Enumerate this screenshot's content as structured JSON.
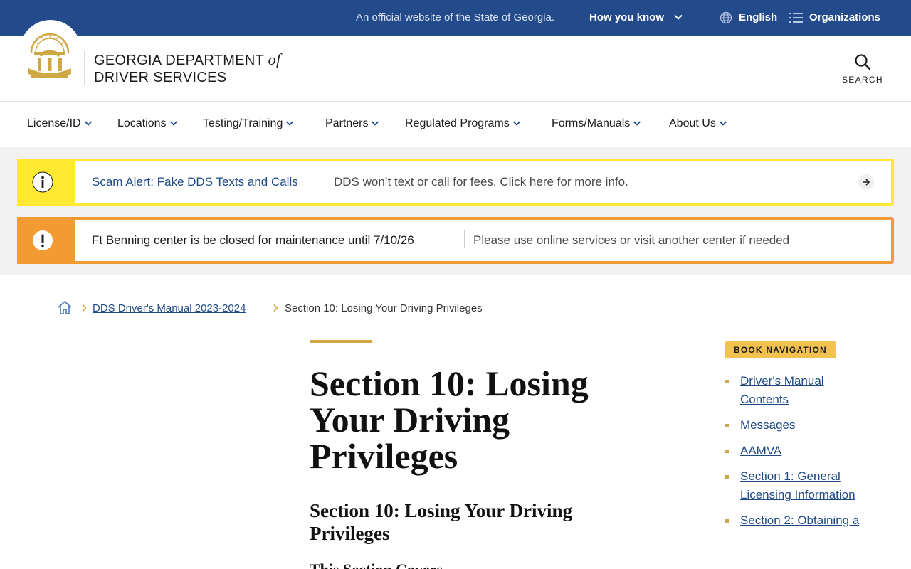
{
  "gov_bar": {
    "official_text": "An official website of the State of Georgia.",
    "how_you_know": "How you know",
    "language": "English",
    "organizations": "Organizations"
  },
  "header": {
    "brand_line1": "GEORGIA DEPARTMENT",
    "brand_of": "of",
    "brand_line2": "DRIVER SERVICES",
    "search_label": "SEARCH"
  },
  "nav": {
    "items": [
      {
        "label": "License/ID"
      },
      {
        "label": "Locations"
      },
      {
        "label": "Testing/Training"
      },
      {
        "label": "Partners"
      },
      {
        "label": "Regulated Programs"
      },
      {
        "label": "Forms/Manuals"
      },
      {
        "label": "About Us"
      }
    ]
  },
  "alerts": [
    {
      "level": "info",
      "color": "#ffe930",
      "icon": "info-icon",
      "title": "Scam Alert: Fake DDS Texts and Calls",
      "message": "DDS won’t text or call for fees. Click here for more info."
    },
    {
      "level": "warning",
      "color": "#f29b33",
      "icon": "exclamation-icon",
      "title": "Ft Benning center is be closed for maintenance until 7/10/26",
      "message": "Please use online services or visit another center if needed"
    }
  ],
  "breadcrumb": {
    "link": "DDS Driver's Manual 2023-2024",
    "current": "Section 10: Losing Your Driving Privileges"
  },
  "article": {
    "title": "Section 10: Losing Your Driving Privileges",
    "subtitle": "Section 10: Losing Your Driving Privileges",
    "next_heading": "This Section Covers"
  },
  "book_nav": {
    "label": "BOOK NAVIGATION",
    "items": [
      {
        "label": "Driver's Manual Contents"
      },
      {
        "label": "Messages"
      },
      {
        "label": "AAMVA"
      },
      {
        "label": "Section 1: General Licensing Information"
      },
      {
        "label": "Section 2: Obtaining a"
      }
    ]
  },
  "colors": {
    "gov_blue": "#234a8b",
    "link_blue": "#1f4a86",
    "gold": "#cfa743",
    "badge_gold": "#f2c14e"
  }
}
